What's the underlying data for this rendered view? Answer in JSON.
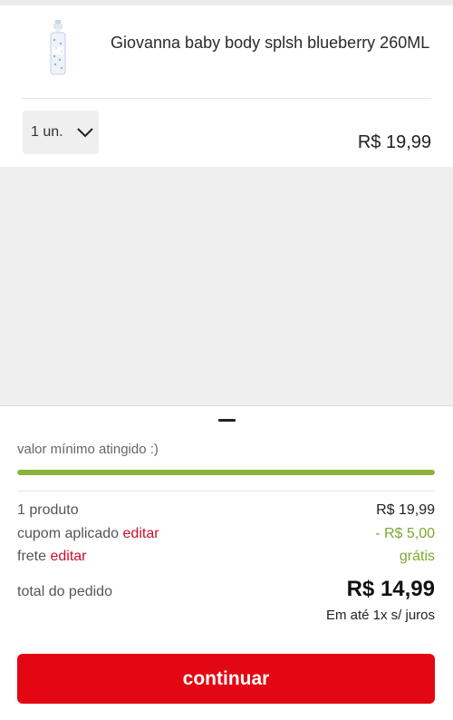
{
  "cart_item": {
    "name": "Giovanna baby body splsh blueberry 260ML",
    "quantity": "1 un.",
    "price": "R$ 19,99",
    "thumb_icon": "spray-bottle-icon"
  },
  "summary": {
    "min_value_message": "valor mínimo atingido :)",
    "progress_fraction": 1.0,
    "products_label": "1 produto",
    "products_value": "R$ 19,99",
    "coupon_label": "cupom aplicado",
    "coupon_edit": "editar",
    "coupon_value": "- R$ 5,00",
    "shipping_label": "frete",
    "shipping_edit": "editar",
    "shipping_value": "grátis",
    "total_label": "total do pedido",
    "total_value": "R$ 14,99",
    "installments": "Em até 1x s/ juros",
    "continue_label": "continuar"
  },
  "colors": {
    "accent_red": "#e30613",
    "link_red": "#c8102e",
    "green": "#7aa92f",
    "progress_green": "#8db33a"
  }
}
